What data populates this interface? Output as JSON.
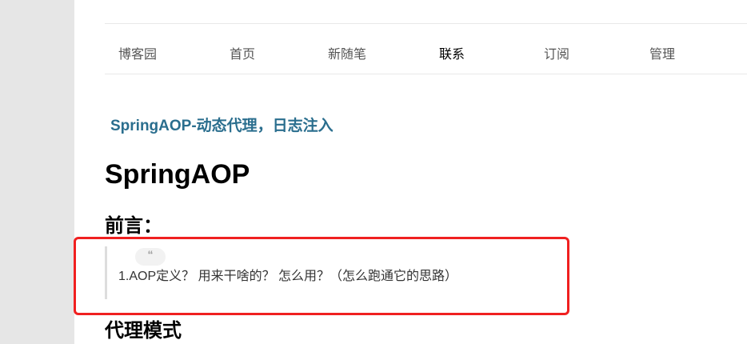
{
  "nav": {
    "items": [
      {
        "label": "博客园"
      },
      {
        "label": "首页"
      },
      {
        "label": "新随笔"
      },
      {
        "label": "联系"
      },
      {
        "label": "订阅"
      },
      {
        "label": "管理"
      }
    ]
  },
  "post": {
    "title": "SpringAOP-动态代理，日志注入",
    "heading1": "SpringAOP",
    "heading2_intro": "前言：",
    "quote_mark": "“",
    "quote_text": "1.AOP定义？ 用来干啥的？ 怎么用？（怎么跑通它的思路）",
    "heading2_proxy": "代理模式"
  },
  "colors": {
    "title_link": "#2a6e8e",
    "highlight_box": "#f02020",
    "background": "#e6e6e6"
  }
}
